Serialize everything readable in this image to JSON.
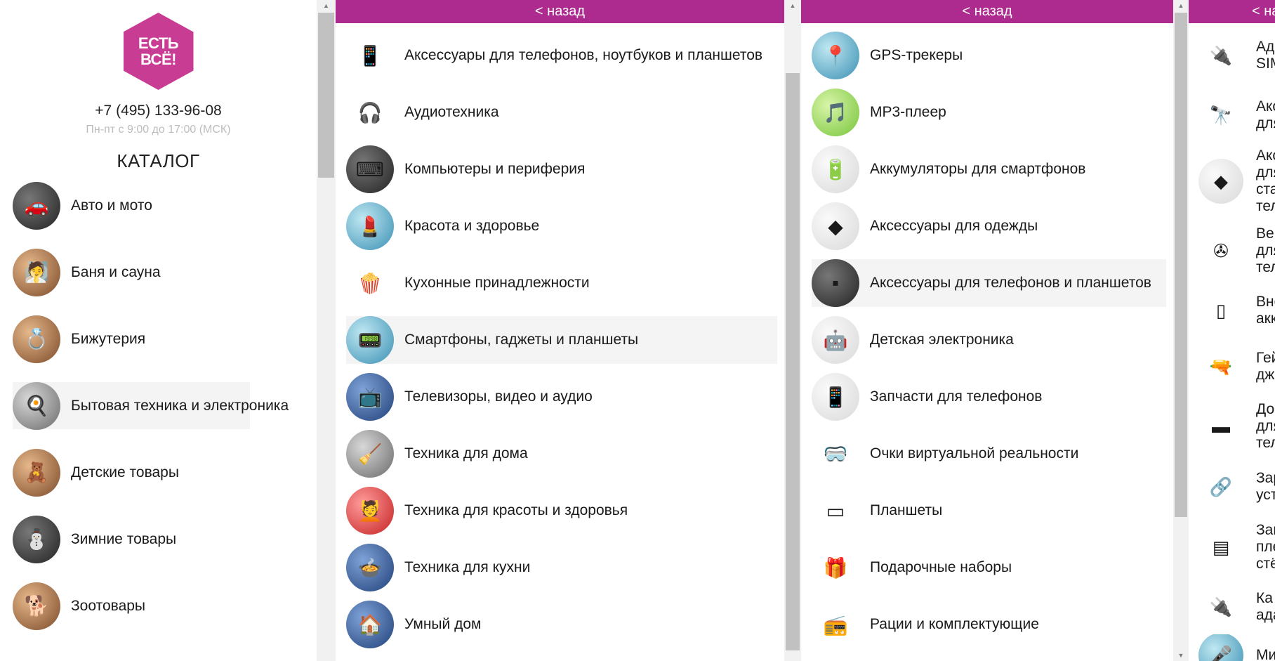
{
  "brand": {
    "logo_line1": "ЕСТЬ",
    "logo_line2": "ВСЁ!",
    "phone": "+7 (495) 133-96-08",
    "hours": "Пн-пт с 9:00 до 17:00 (МСК)",
    "accent_color": "#ad2b8e"
  },
  "catalog": {
    "title": "КАТАЛОГ",
    "items": [
      {
        "label": "Авто и мото",
        "icon": "car-icon"
      },
      {
        "label": "Баня и сауна",
        "icon": "sauna-icon"
      },
      {
        "label": "Бижутерия",
        "icon": "jewelry-icon"
      },
      {
        "label": "Бытовая техника и электроника",
        "icon": "appliance-icon",
        "active": true
      },
      {
        "label": "Детские товары",
        "icon": "kids-icon"
      },
      {
        "label": "Зимние товары",
        "icon": "winter-icon"
      },
      {
        "label": "Зоотовары",
        "icon": "pet-icon"
      }
    ]
  },
  "level2": {
    "back_label": "< назад",
    "items": [
      {
        "label": "Аксессуары для телефонов, ноутбуков и планшетов",
        "icon": "phone-icon"
      },
      {
        "label": "Аудиотехника",
        "icon": "headphones-icon"
      },
      {
        "label": "Компьютеры и периферия",
        "icon": "keyboard-icon"
      },
      {
        "label": "Красота и здоровье",
        "icon": "beauty-icon"
      },
      {
        "label": "Кухонные принадлежности",
        "icon": "popcorn-icon"
      },
      {
        "label": "Смартфоны, гаджеты и планшеты",
        "icon": "gadget-icon",
        "active": true
      },
      {
        "label": "Телевизоры, видео и аудио",
        "icon": "tv-icon"
      },
      {
        "label": "Техника для дома",
        "icon": "vacuum-icon"
      },
      {
        "label": "Техника для красоты и здоровья",
        "icon": "massager-icon"
      },
      {
        "label": "Техника для кухни",
        "icon": "kitchen-icon"
      },
      {
        "label": "Умный дом",
        "icon": "smart-home-icon"
      }
    ]
  },
  "level3": {
    "back_label": "< назад",
    "items": [
      {
        "label": "GPS-трекеры",
        "icon": "gps-icon"
      },
      {
        "label": "MP3-плеер",
        "icon": "mp3-icon"
      },
      {
        "label": "Аккумуляторы для смартфонов",
        "icon": "battery-icon"
      },
      {
        "label": "Аксессуары для одежды",
        "icon": "placeholder-icon"
      },
      {
        "label": "Аксессуары для телефонов и планшетов",
        "icon": "powerbank-icon",
        "active": true
      },
      {
        "label": "Детская электроника",
        "icon": "robot-icon"
      },
      {
        "label": "Запчасти для телефонов",
        "icon": "smartphone-icon"
      },
      {
        "label": "Очки виртуальной реальности",
        "icon": "vr-icon"
      },
      {
        "label": "Планшеты",
        "icon": "tablet-icon"
      },
      {
        "label": "Подарочные наборы",
        "icon": "gift-icon"
      },
      {
        "label": "Рации и комплектующие",
        "icon": "radio-icon"
      }
    ]
  },
  "level4": {
    "back_label": "< на",
    "items": [
      {
        "label": "Ад\nSIM",
        "icon": "sim-adapter-icon"
      },
      {
        "label": "Акс\nдля",
        "icon": "lens-icon"
      },
      {
        "label": "Акс\nдля\nста\nтел",
        "icon": "placeholder-icon"
      },
      {
        "label": "Вен\nдля\nтел",
        "icon": "fan-icon"
      },
      {
        "label": "Вне\nакк",
        "icon": "powerbank-icon"
      },
      {
        "label": "Гей\nдж",
        "icon": "gun-icon"
      },
      {
        "label": "До\nдля\nтел",
        "icon": "dock-icon"
      },
      {
        "label": "Зар\nуст",
        "icon": "cable-icon"
      },
      {
        "label": "Заг\nпле\nстё",
        "icon": "film-icon"
      },
      {
        "label": "Ка\nада",
        "icon": "usb-cable-icon"
      },
      {
        "label": "Ми",
        "icon": "mic-icon"
      }
    ]
  }
}
